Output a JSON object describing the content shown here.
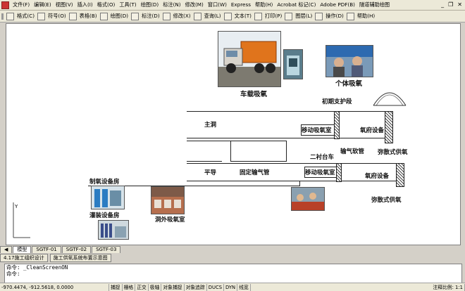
{
  "menubar": {
    "items": [
      "文件(F)",
      "编辑(E)",
      "视图(V)",
      "插入(I)",
      "格式(O)",
      "工具(T)",
      "绘图(D)",
      "标注(N)",
      "修改(M)",
      "窗口(W)",
      "Express",
      "帮助(H)",
      "Acrobat 标记(C)",
      "Adobe PDF(B)",
      "隧道辅助绘图"
    ]
  },
  "toolbar": {
    "items": [
      "格式(C)",
      "符号(O)",
      "表格(B)",
      "绘图(D)",
      "标注(D)",
      "修改(X)",
      "查询(L)",
      "文本(T)",
      "打印(P)",
      "图层(L)",
      "操作(D)",
      "帮助(H)"
    ]
  },
  "drawing": {
    "labels": {
      "truck": "车载吸氧",
      "individual": "个体吸氧",
      "support": "初期支护段",
      "main_tunnel": "主洞",
      "mobile_room1": "移动吸氧室",
      "oxygen_equipment1": "氧府设备",
      "dispersion1": "弥散式供氧",
      "secondary_lining": "二衬台车",
      "oxygen_pipe": "输气软管",
      "pingdao": "平导",
      "fixed_pipe": "固定输气管",
      "mobile_room2": "移动吸氧室",
      "oxygen_equipment2": "氧府设备",
      "dispersion2": "弥散式供氧",
      "oxygen_plant": "制氧设备房",
      "filling_room": "灌装设备房",
      "outside_room": "洞外吸氧室"
    }
  },
  "tabs": [
    "模型",
    "SGTF-01",
    "SGTF-02",
    "SGTF-03"
  ],
  "taskbar": [
    "4.17施工组织设计",
    "施工供氧系统布置示意图"
  ],
  "command": {
    "line1": "命令: _CleanScreenON",
    "line2": "命令:"
  },
  "status": {
    "coords": "-970.4474, -912.5618, 0.0000",
    "toggles": [
      "捕捉",
      "栅格",
      "正交",
      "极轴",
      "对象捕捉",
      "对象追踪",
      "DUCS",
      "DYN",
      "线宽"
    ],
    "scale": "注释比例: 1:1"
  }
}
